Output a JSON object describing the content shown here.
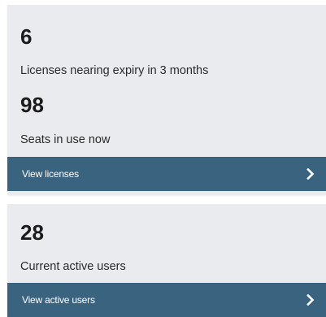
{
  "cards": [
    {
      "stats": [
        {
          "value": "6",
          "label": "Licenses nearing expiry in 3 months"
        },
        {
          "value": "98",
          "label": "Seats in use now"
        }
      ],
      "link_label": "View licenses"
    },
    {
      "stats": [
        {
          "value": "28",
          "label": "Current active users"
        }
      ],
      "link_label": "View active users"
    }
  ],
  "icons": {
    "link_arrow": "chevron-right-icon"
  },
  "colors": {
    "card_background": "#e9ebee",
    "footer_bar": "#3a6380",
    "footer_text": "#ffffff",
    "stat_text": "#1b1b1b"
  }
}
